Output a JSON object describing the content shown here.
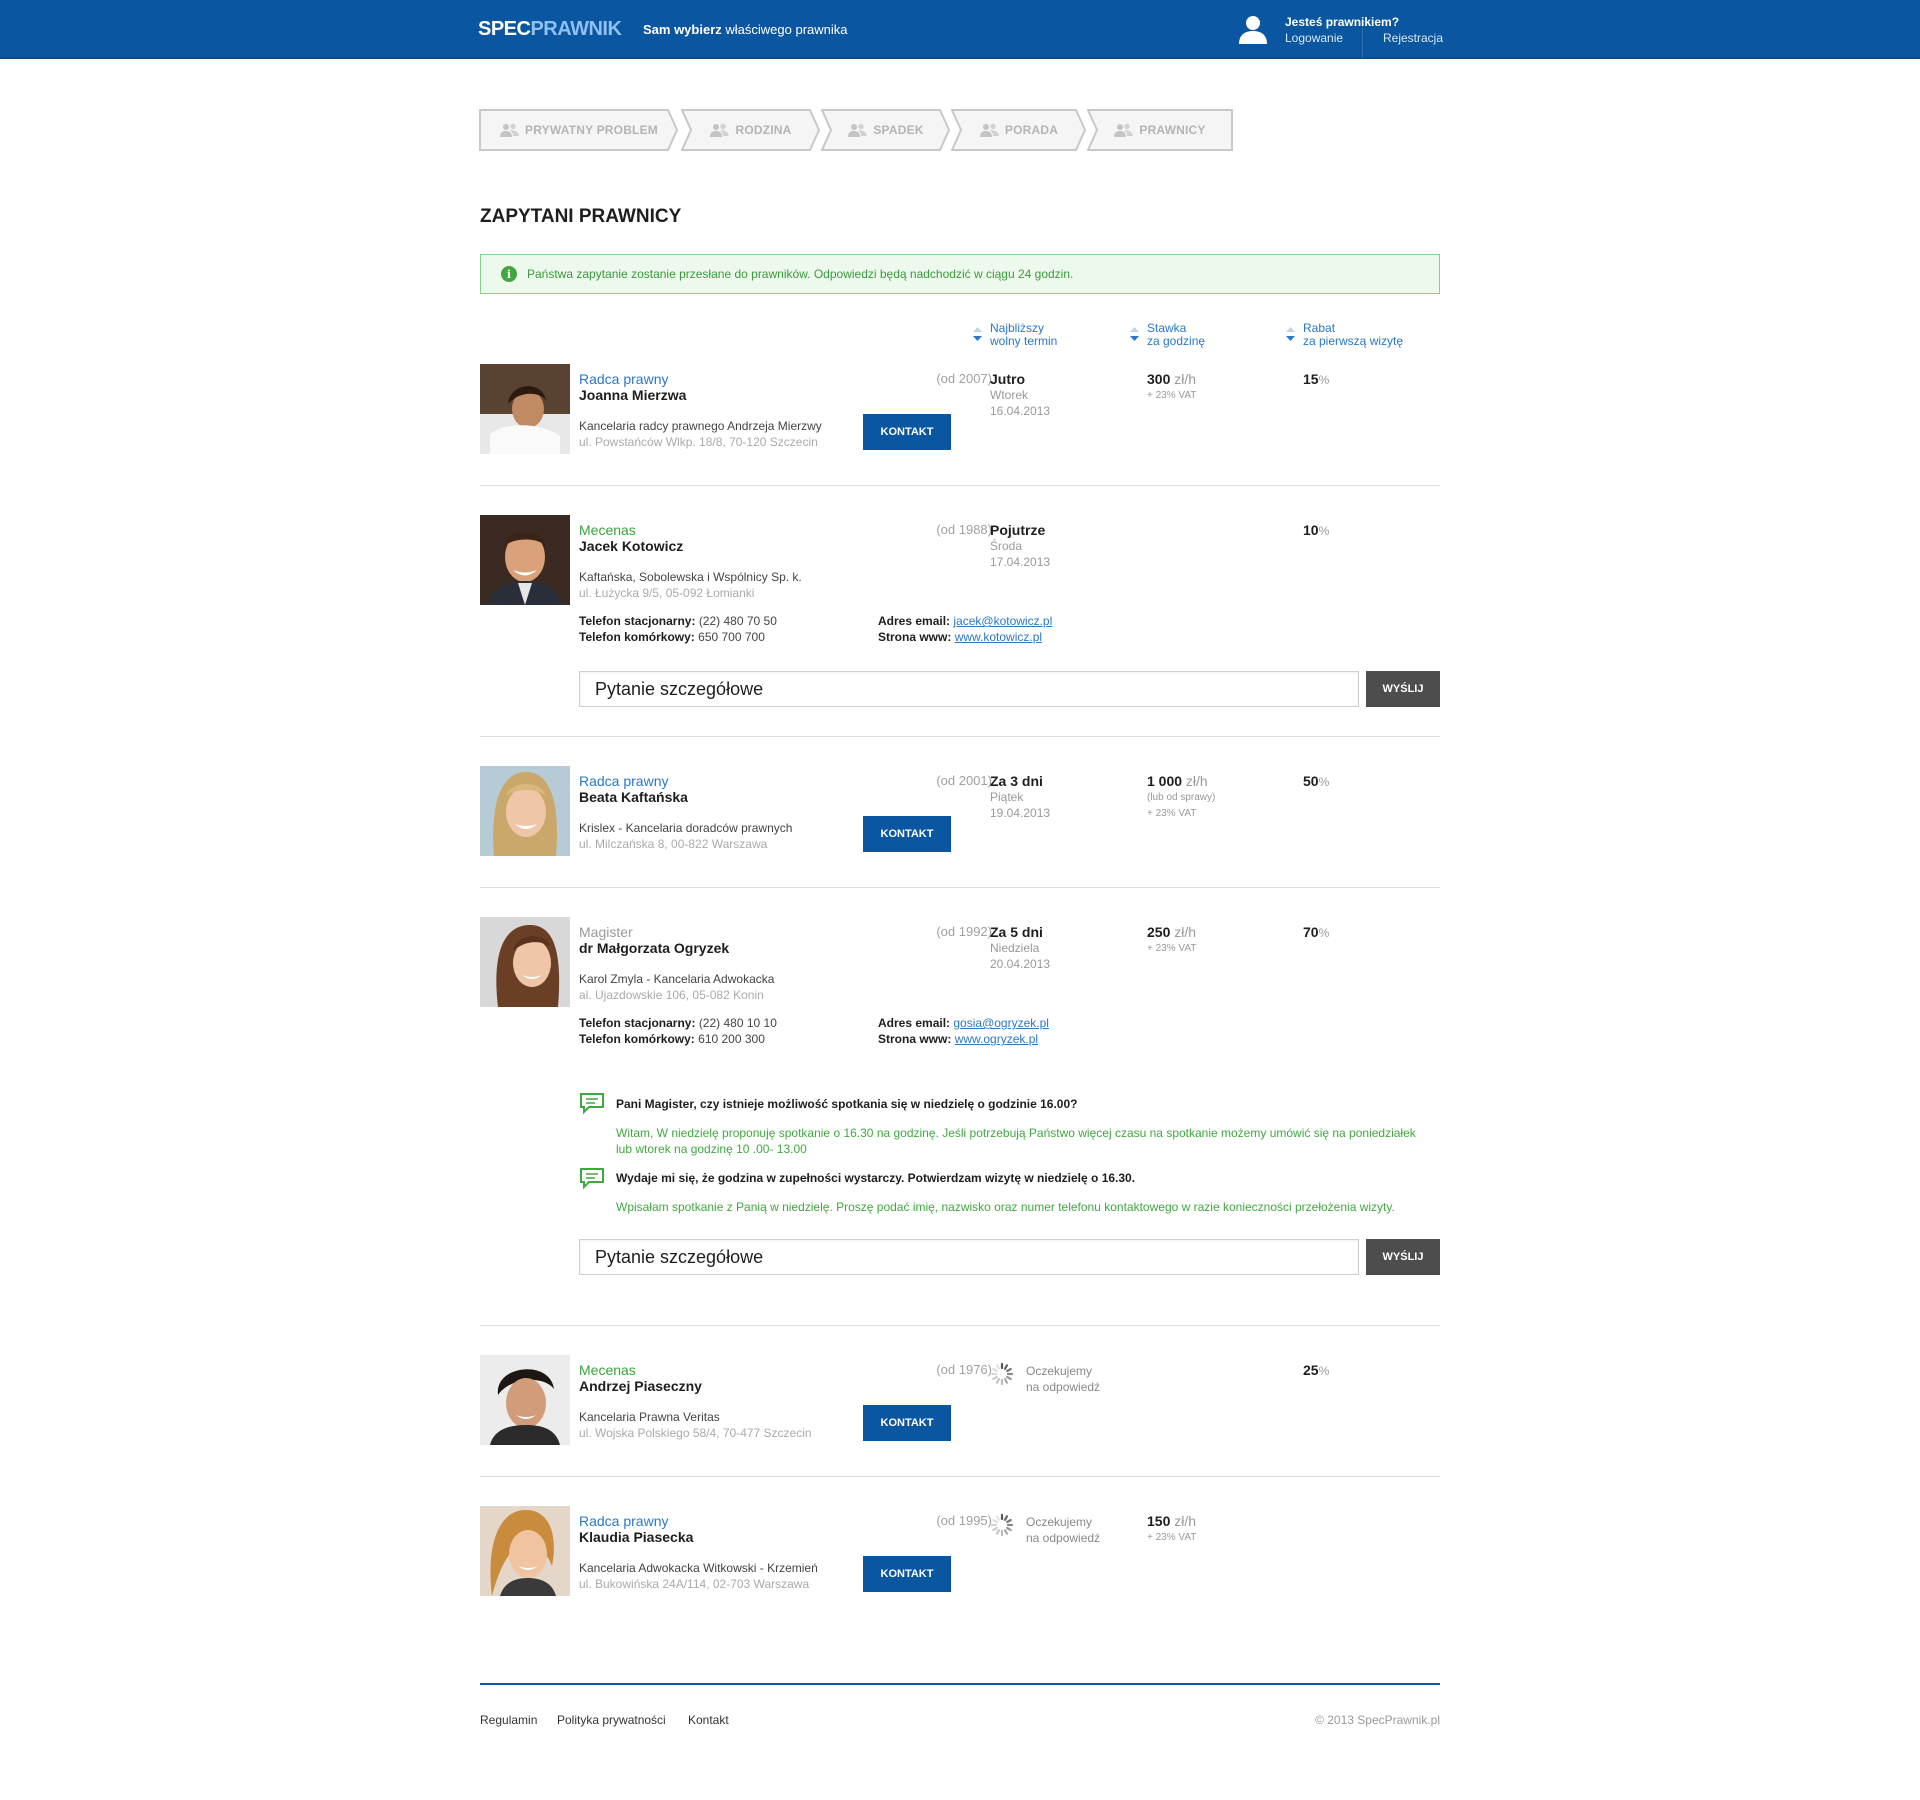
{
  "header": {
    "logo_part1": "SPEC",
    "logo_part2": "PRAWNIK",
    "tagline_bold": "Sam wybierz",
    "tagline_rest": " właściwego prawnika",
    "lawyer_question": "Jesteś prawnikiem?",
    "login": "Logowanie",
    "register": "Rejestracja"
  },
  "steps": [
    "PRYWATNY PROBLEM",
    "RODZINA",
    "SPADEK",
    "PORADA",
    "PRAWNICY"
  ],
  "page_title": "ZAPYTANI PRAWNICY",
  "notice": "Państwa zapytanie zostanie przesłane do prawników. Odpowiedzi będą nadchodzić w ciągu 24 godzin.",
  "columns": {
    "term": [
      "Najbliższy",
      "wolny termin"
    ],
    "rate": [
      "Stawka",
      "za godzinę"
    ],
    "discount": [
      "Rabat",
      "za pierwszą wizytę"
    ]
  },
  "lawyers": [
    {
      "role": "Radca prawny",
      "name": "Joanna Mierzwa",
      "since": "(od 2007)",
      "office": "Kancelaria radcy prawnego Andrzeja Mierzwy",
      "address": "ul. Powstańców Wlkp. 18/8, 70-120 Szczecin",
      "button": "KONTAKT",
      "term_day": "Jutro",
      "term_weekday": "Wtorek",
      "term_date": "16.04.2013",
      "rate_value": "300",
      "rate_unit": " zł/h",
      "rate_vat": "+ 23% VAT",
      "discount": "15",
      "discount_unit": "%"
    },
    {
      "role": "Mecenas",
      "name": "Jacek Kotowicz",
      "since": "(od 1988)",
      "office": "Kaftańska, Sobolewska i Wspólnicy Sp. k.",
      "address": "ul. Łużycka 9/5, 05-092 Łomianki",
      "term_day": "Pojutrze",
      "term_weekday": "Środa",
      "term_date": "17.04.2013",
      "discount": "10",
      "discount_unit": "%",
      "phone_label": "Telefon stacjonarny:",
      "phone": "(22) 480 70 50",
      "mobile_label": "Telefon komórkowy:",
      "mobile": "650 700 700",
      "email_label": "Adres email:",
      "email": "jacek@kotowicz.pl",
      "www_label": "Strona www:",
      "www": "www.kotowicz.pl",
      "ask_placeholder": "Pytanie szczegółowe",
      "send": "WYŚLIJ"
    },
    {
      "role": "Radca prawny",
      "name": "Beata Kaftańska",
      "since": "(od 2001)",
      "office": "Krislex - Kancelaria doradców prawnych",
      "address": "ul. Milczańska 8, 00-822 Warszawa",
      "button": "KONTAKT",
      "term_day": "Za 3 dni",
      "term_weekday": "Piątek",
      "term_date": "19.04.2013",
      "rate_value": "1 000",
      "rate_unit": " zł/h",
      "rate_note": "(lub od sprawy)",
      "rate_vat": "+ 23% VAT",
      "discount": "50",
      "discount_unit": "%"
    },
    {
      "role": "Magister",
      "name": "dr Małgorzata Ogryzek",
      "since": "(od 1992)",
      "office": "Karol Zmyla - Kancelaria Adwokacka",
      "address": "al. Ujazdowskie 106, 05-082 Konin",
      "term_day": "Za 5 dni",
      "term_weekday": "Niedziela",
      "term_date": "20.04.2013",
      "rate_value": "250",
      "rate_unit": " zł/h",
      "rate_vat": "+ 23% VAT",
      "discount": "70",
      "discount_unit": "%",
      "phone_label": "Telefon stacjonarny:",
      "phone": "(22) 480 10 10",
      "mobile_label": "Telefon komórkowy:",
      "mobile": "610 200 300",
      "email_label": "Adres email:",
      "email": "gosia@ogryzek.pl",
      "www_label": "Strona www:",
      "www": "www.ogryzek.pl",
      "messages": [
        {
          "question": "Pani Magister, czy istnieje możliwość spotkania się w niedzielę o godzinie 16.00?",
          "answer": "Witam, W niedzielę proponuję spotkanie o 16.30 na godzinę. Jeśli potrzebują Państwo więcej czasu na spotkanie możemy umówić się na poniedziałek lub wtorek na godzinę 10 .00- 13.00"
        },
        {
          "question": "Wydaje mi się, że godzina w zupełności wystarczy. Potwierdzam wizytę w niedzielę o 16.30.",
          "answer": "Wpisałam spotkanie z Panią w niedzielę. Proszę podać imię, nazwisko oraz numer telefonu kontaktowego w razie konieczności przełożenia wizyty."
        }
      ],
      "ask_placeholder": "Pytanie szczegółowe",
      "send": "WYŚLIJ"
    },
    {
      "role": "Mecenas",
      "name": "Andrzej Piaseczny",
      "since": "(od 1976)",
      "office": "Kancelaria Prawna Veritas",
      "address": "ul. Wojska Polskiego 58/4, 70-477 Szczecin",
      "button": "KONTAKT",
      "wait1": "Oczekujemy",
      "wait2": "na odpowiedź",
      "discount": "25",
      "discount_unit": "%"
    },
    {
      "role": "Radca prawny",
      "name": "Klaudia Piasecka",
      "since": "(od 1995)",
      "office": "Kancelaria Adwokacka Witkowski - Krzemień",
      "address": "ul. Bukowińska 24A/114, 02-703 Warszawa",
      "button": "KONTAKT",
      "wait1": "Oczekujemy",
      "wait2": "na odpowiedź",
      "rate_value": "150",
      "rate_unit": " zł/h",
      "rate_vat": "+ 23% VAT"
    }
  ],
  "footer": {
    "links": [
      "Regulamin",
      "Polityka prywatności",
      "Kontakt"
    ],
    "copyright": "© 2013 SpecPrawnik.pl"
  },
  "colors": {
    "brand_blue": "#0a56a0",
    "link_blue": "#2a78c5",
    "green": "#41a741",
    "dark_button": "#4d4d4d"
  }
}
